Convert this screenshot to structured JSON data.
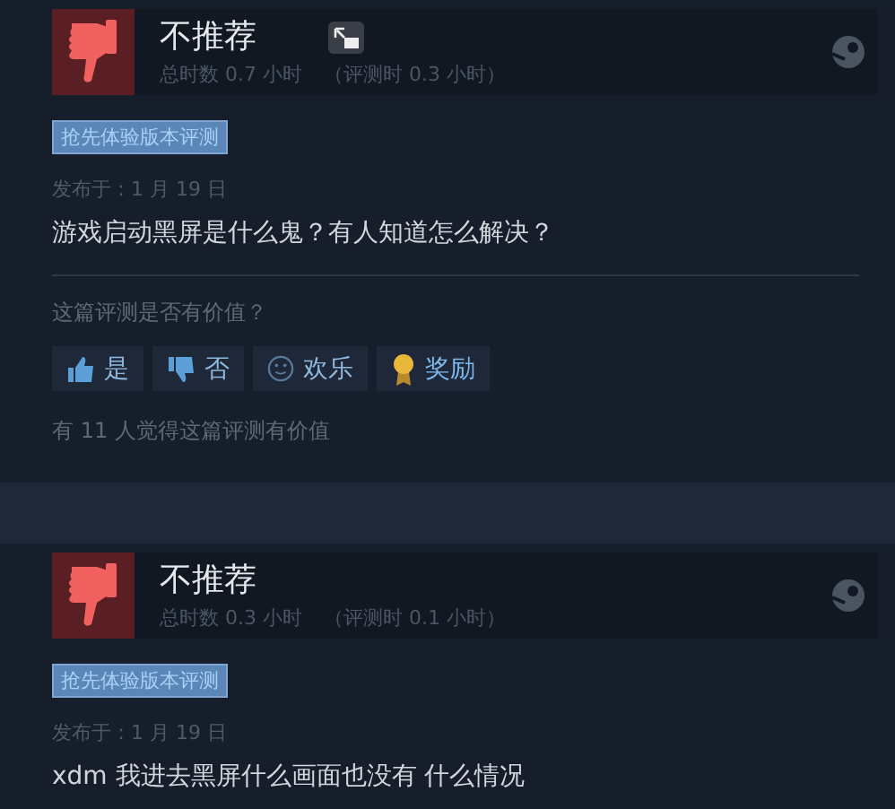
{
  "reviews": [
    {
      "verdict": "不推荐",
      "recommended": false,
      "window_icon": true,
      "playtime": "总时数 0.7 小时",
      "review_time": "（评测时 0.3 小时）",
      "tag": "抢先体验版本评测",
      "posted": "发布于：1 月 19 日",
      "body": "游戏启动黑屏是什么鬼？有人知道怎么解决？",
      "feedback": {
        "question": "这篇评测是否有价值？",
        "buttons": [
          {
            "kind": "yes",
            "label": "是"
          },
          {
            "kind": "no",
            "label": "否"
          },
          {
            "kind": "funny",
            "label": "欢乐"
          },
          {
            "kind": "award",
            "label": "奖励"
          }
        ],
        "count": "有 11 人觉得这篇评测有价值"
      }
    },
    {
      "verdict": "不推荐",
      "recommended": false,
      "window_icon": false,
      "playtime": "总时数 0.3 小时",
      "review_time": "（评测时 0.1 小时）",
      "tag": "抢先体验版本评测",
      "posted": "发布于：1 月 19 日",
      "body": "xdm 我进去黑屏什么画面也没有 什么情况"
    }
  ]
}
